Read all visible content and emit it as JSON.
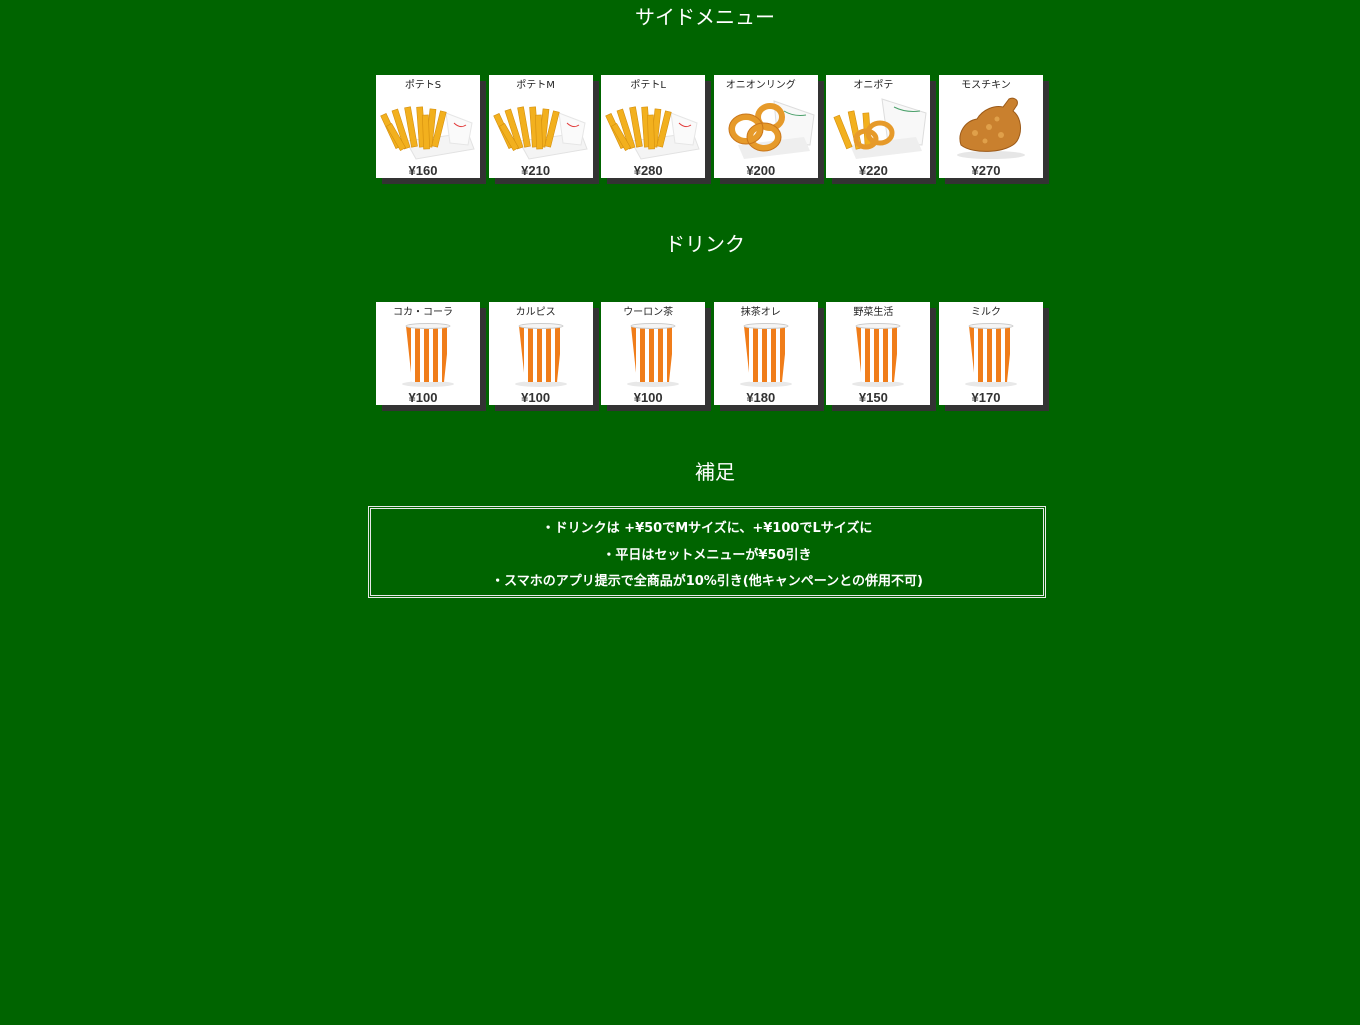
{
  "sections": {
    "side_title": "サイドメニュー",
    "drink_title": "ドリンク",
    "notes_title": "補足"
  },
  "side_items": [
    {
      "name": "ポテトS",
      "price": "¥160",
      "icon": "fries-icon"
    },
    {
      "name": "ポテトM",
      "price": "¥210",
      "icon": "fries-icon"
    },
    {
      "name": "ポテトL",
      "price": "¥280",
      "icon": "fries-icon"
    },
    {
      "name": "オニオンリング",
      "price": "¥200",
      "icon": "onion-rings-icon"
    },
    {
      "name": "オニポテ",
      "price": "¥220",
      "icon": "onion-fries-icon"
    },
    {
      "name": "モスチキン",
      "price": "¥270",
      "icon": "fried-chicken-icon"
    }
  ],
  "drink_items": [
    {
      "name": "コカ・コーラ",
      "price": "¥100",
      "icon": "drink-cup-icon"
    },
    {
      "name": "カルピス",
      "price": "¥100",
      "icon": "drink-cup-icon"
    },
    {
      "name": "ウーロン茶",
      "price": "¥100",
      "icon": "drink-cup-icon"
    },
    {
      "name": "抹茶オレ",
      "price": "¥180",
      "icon": "drink-cup-icon"
    },
    {
      "name": "野菜生活",
      "price": "¥150",
      "icon": "drink-cup-icon"
    },
    {
      "name": "ミルク",
      "price": "¥170",
      "icon": "drink-cup-icon"
    }
  ],
  "notes": [
    "・ドリンクは +¥50でMサイズに、+¥100でLサイズに",
    "・平日はセットメニューが¥50引き",
    "・スマホのアプリ提示で全商品が10%引き(他キャンペーンとの併用不可)"
  ],
  "colors": {
    "background": "#006400",
    "card": "#ffffff",
    "shadow": "#333333",
    "fries": "#f2b01e",
    "cup_stripe": "#f07d1a"
  }
}
